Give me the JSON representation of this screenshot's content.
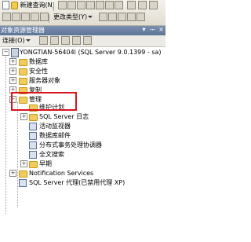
{
  "toolbar": {
    "new_query_label": "新建查询(N)",
    "change_type_label": "更改类型(Y)"
  },
  "panel": {
    "title": "对象资源管理器",
    "connect_label": "连接(O)"
  },
  "tree": {
    "server": "YONGTIAN-56404l (SQL Server 9.0.1399 - sa)",
    "items": [
      {
        "label": "数据库"
      },
      {
        "label": "安全性"
      },
      {
        "label": "服务器对象"
      },
      {
        "label": "复制"
      },
      {
        "label": "管理"
      },
      {
        "label": "维护计划"
      },
      {
        "label": "SQL Server 日志"
      },
      {
        "label": "活动监视器"
      },
      {
        "label": "数据库邮件"
      },
      {
        "label": "分布式事务处理协调器"
      },
      {
        "label": "全文搜索"
      },
      {
        "label": "早期"
      },
      {
        "label": "Notification Services"
      },
      {
        "label": "SQL Server 代理(已禁用代理 XP)"
      }
    ]
  },
  "colors": {
    "highlight_border": "#d9141c",
    "title_bar": "#6a80a4"
  }
}
